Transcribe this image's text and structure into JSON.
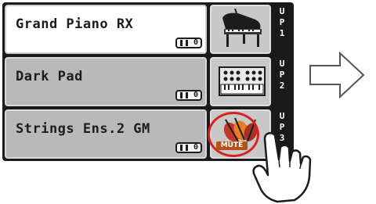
{
  "parts": [
    {
      "name": "Grand Piano RX",
      "octave": "0",
      "part_label": [
        "U",
        "P",
        "1"
      ],
      "icon": "grand-piano-icon",
      "selected": true,
      "muted": false
    },
    {
      "name": "Dark Pad",
      "octave": "0",
      "part_label": [
        "U",
        "P",
        "2"
      ],
      "icon": "synth-keyboard-icon",
      "selected": false,
      "muted": false
    },
    {
      "name": "Strings Ens.2 GM",
      "octave": "0",
      "part_label": [
        "U",
        "P",
        "3"
      ],
      "icon": "strings-icon",
      "selected": false,
      "muted": true,
      "mute_label": "MUTE"
    }
  ],
  "colors": {
    "mute_ring": "#d92020",
    "mute_badge": "#b0521a",
    "selected_bg": "#ffffff",
    "normal_bg": "#b9b9b9"
  },
  "pointer": "tapping-hand-icon",
  "arrow": "right-arrow-icon"
}
